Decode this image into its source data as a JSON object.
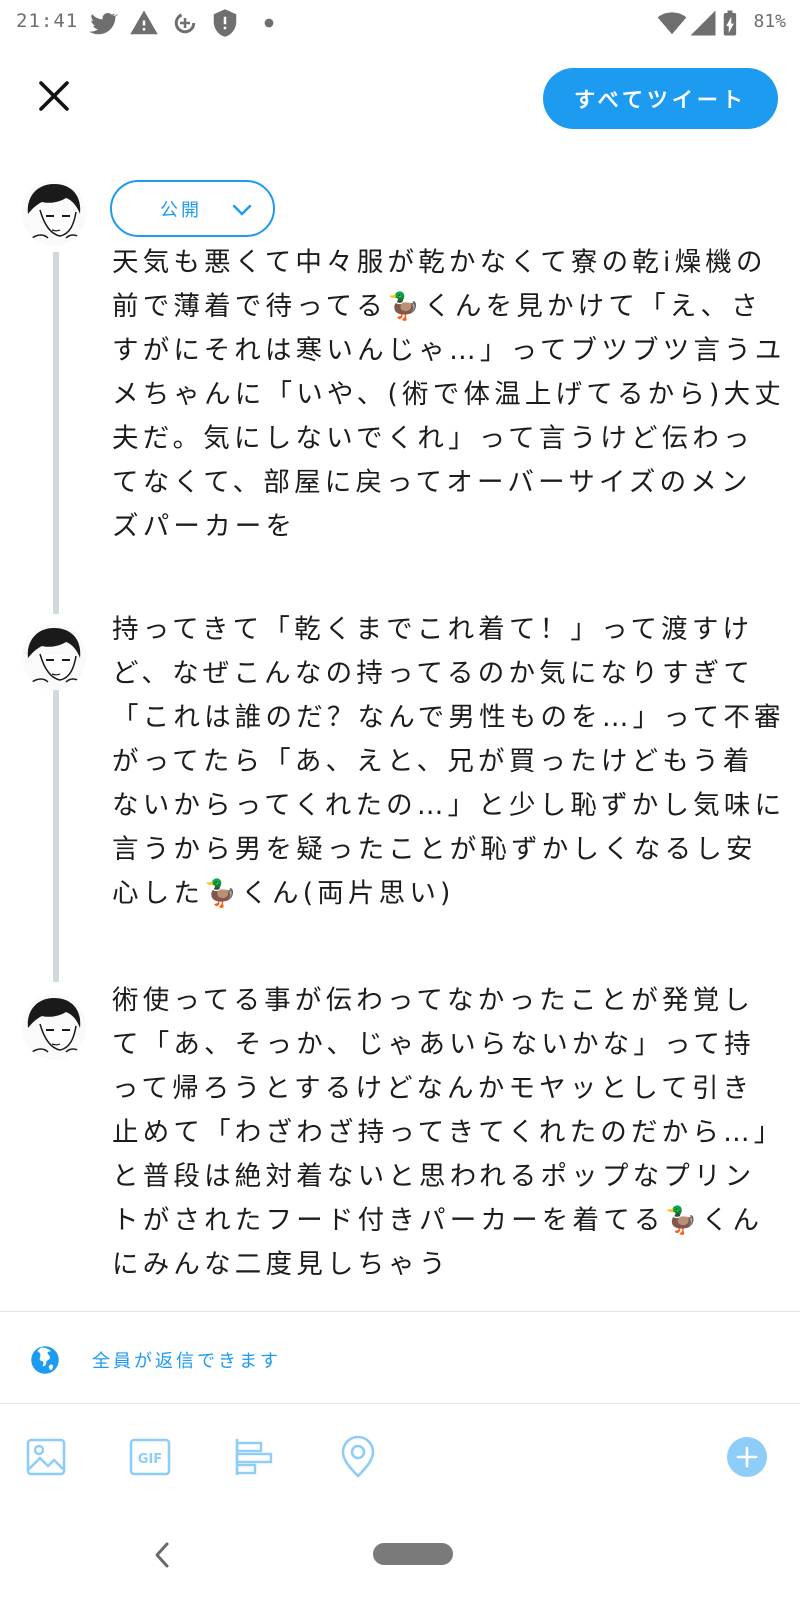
{
  "status_bar": {
    "time": "21:41",
    "battery_text": "81%",
    "left_icons": [
      "twitter-icon",
      "warning-icon",
      "data-saver-icon",
      "shield-alert-icon",
      "notification-dot-icon"
    ],
    "right_icons": [
      "wifi-icon",
      "cellular-icon",
      "battery-icon"
    ]
  },
  "header": {
    "close_icon": "close-icon",
    "tweet_all_label": "すべてツイート"
  },
  "audience": {
    "label": "公開",
    "icon": "chevron-down-icon"
  },
  "tweets": [
    {
      "avatar": "user-avatar",
      "lines": [
        "天気も悪くて中々服が乾かなくて寮の乾i燥機の",
        "前で薄着で待ってる🦆くんを見かけて「え、さ",
        "すがにそれは寒いんじゃ…」ってブツブツ言うユ",
        "メちゃんに「いや、(術で体温上げてるから)大丈",
        "夫だ。気にしないでくれ」って言うけど伝わっ",
        "てなくて、部屋に戻ってオーバーサイズのメン",
        "ズパーカーを"
      ]
    },
    {
      "avatar": "user-avatar",
      "lines": [
        "持ってきて「乾くまでこれ着て！」って渡すけ",
        "ど、なぜこんなの持ってるのか気になりすぎて",
        "「これは誰のだ？なんで男性ものを…」って不審",
        "がってたら「あ、えと、兄が買ったけどもう着",
        "ないからってくれたの…」と少し恥ずかし気味に",
        "言うから男を疑ったことが恥ずかしくなるし安",
        "心した🦆くん(両片思い)"
      ]
    },
    {
      "avatar": "user-avatar",
      "lines": [
        "術使ってる事が伝わってなかったことが発覚し",
        "て「あ、そっか、じゃあいらないかな」って持",
        "って帰ろうとするけどなんかモヤッとして引き",
        "止めて「わざわざ持ってきてくれたのだから…」",
        "と普段は絶対着ないと思われるポップなプリン",
        "トがされたフード付きパーカーを着てる🦆くん",
        "にみんな二度見しちゃう"
      ]
    }
  ],
  "reply_setting": {
    "icon": "globe-icon",
    "label": "全員が返信できます"
  },
  "toolbar": {
    "icons": [
      "image-icon",
      "gif-icon",
      "poll-icon",
      "location-icon"
    ],
    "add_icon": "plus-icon"
  },
  "colors": {
    "accent": "#1d9bf0",
    "accent_disabled": "#8ecdf8",
    "thread_line": "#cfd9de",
    "text": "#1c1c1c"
  }
}
